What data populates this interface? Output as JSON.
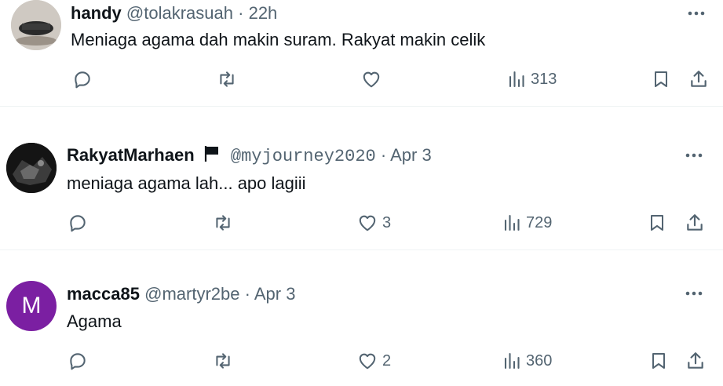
{
  "tweets": [
    {
      "name": "handy",
      "handle": "@tolakrasuah",
      "sep": "·",
      "time": "22h",
      "text": "Meniaga agama dah makin suram. Rakyat makin celik",
      "replies": "",
      "reposts": "",
      "likes": "",
      "views": "313"
    },
    {
      "name": "RakyatMarhaen",
      "handle": "@myjourney2020",
      "sep": "·",
      "time": "Apr 3",
      "text": "meniaga agama lah... apo lagiii",
      "replies": "",
      "reposts": "",
      "likes": "3",
      "views": "729"
    },
    {
      "name": "macca85",
      "handle": "@martyr2be",
      "sep": "·",
      "time": "Apr 3",
      "avatar_letter": "M",
      "avatar_color": "#7b1fa2",
      "text": "Agama",
      "replies": "",
      "reposts": "",
      "likes": "2",
      "views": "360"
    }
  ],
  "icons": {
    "more": "more-dots-icon",
    "reply": "reply-bubble-icon",
    "repost": "repost-arrows-icon",
    "like": "heart-icon",
    "views": "bar-chart-icon",
    "bookmark": "bookmark-icon",
    "share": "share-upload-icon"
  },
  "colors": {
    "text": "#0f1419",
    "secondary": "#536471",
    "divider": "#eff3f4"
  }
}
